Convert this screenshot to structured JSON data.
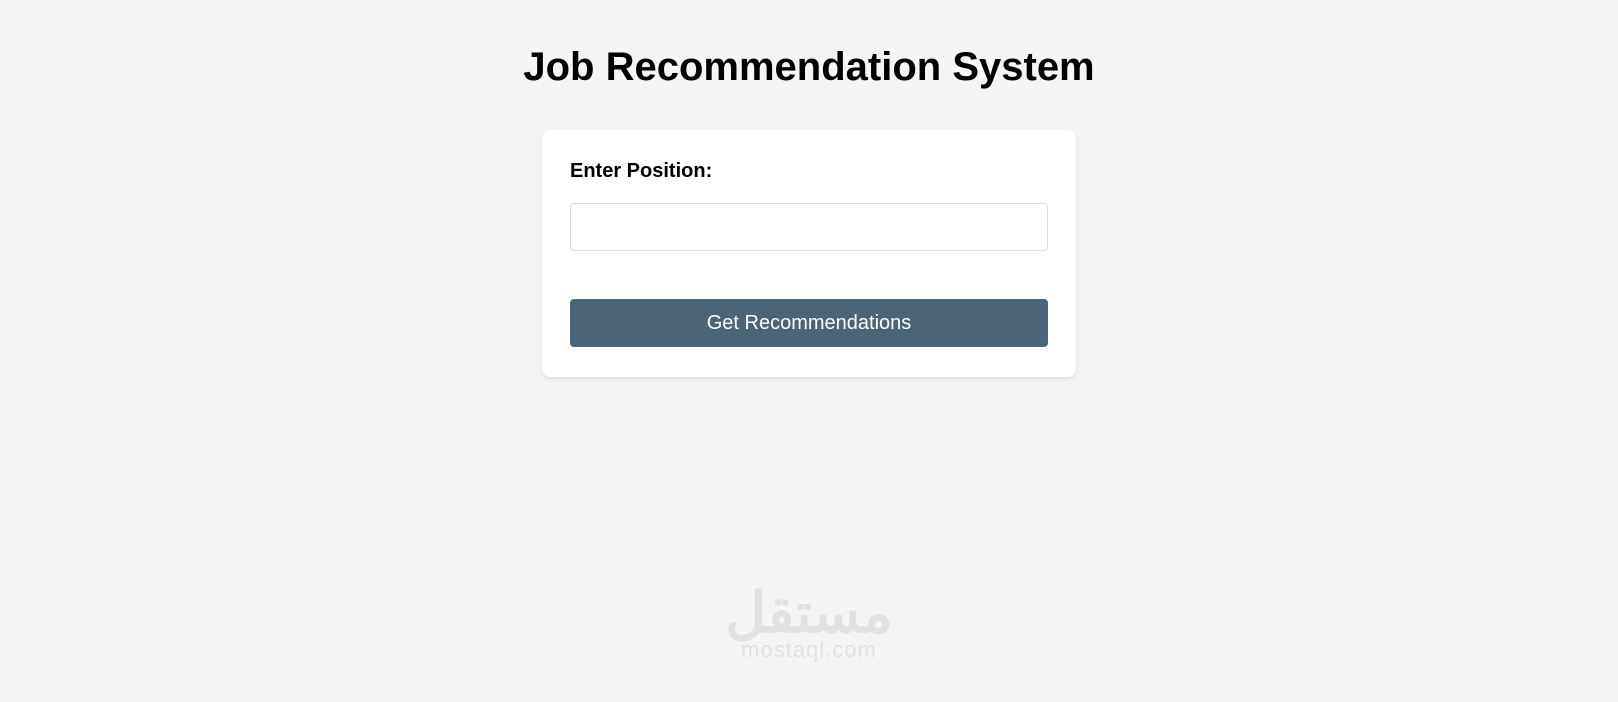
{
  "header": {
    "title": "Job Recommendation System"
  },
  "form": {
    "position_label": "Enter Position:",
    "position_value": "",
    "position_placeholder": "",
    "submit_label": "Get Recommendations"
  },
  "watermark": {
    "arabic_text": "مستقل",
    "latin_text": "mostaql.com"
  }
}
